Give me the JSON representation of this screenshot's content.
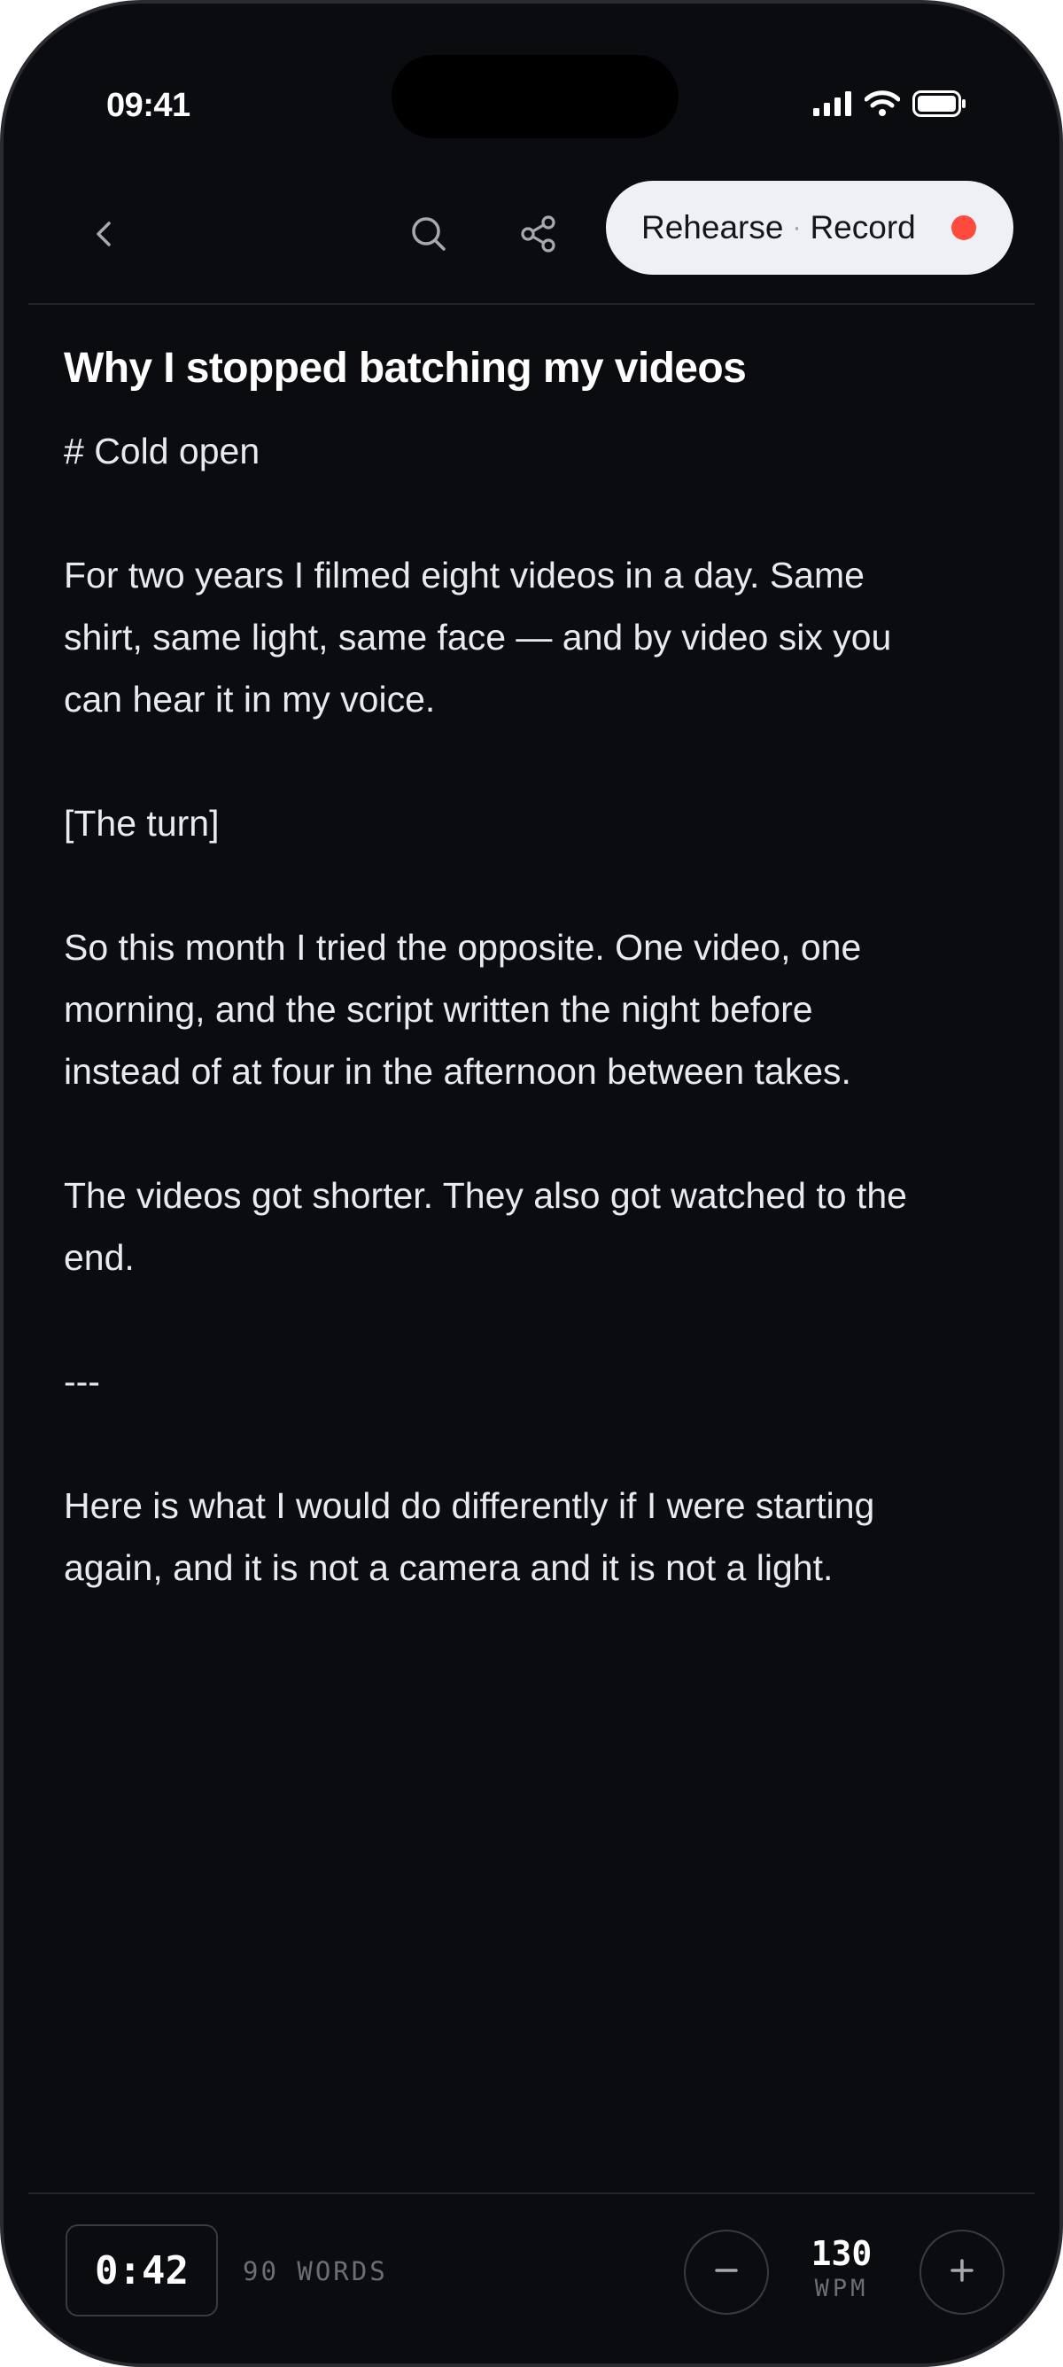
{
  "status_bar": {
    "time": "09:41",
    "icons": [
      "cellular-signal-icon",
      "wifi-icon",
      "battery-icon"
    ]
  },
  "toolbar": {
    "back_icon": "chevron-left-icon",
    "search_icon": "search-icon",
    "share_icon": "share-icon",
    "mode_primary": "Rehearse",
    "mode_separator": "·",
    "mode_secondary": "Record",
    "record_dot_color": "#ff4b3e"
  },
  "document": {
    "title": "Why I stopped batching my videos",
    "lines": [
      "# Cold open",
      "",
      "For two years I filmed eight videos in a day. Same",
      "shirt, same light, same face — and by video six you",
      "can hear it in my voice.",
      "",
      "[The turn]",
      "",
      "So this month I tried the opposite. One video, one",
      "morning, and the script written the night before",
      "instead of at four in the afternoon between takes.",
      "",
      "The videos got shorter. They also got watched to the",
      "end.",
      "",
      "---",
      "",
      "Here is what I would do differently if I were starting",
      "again, and it is not a camera and it is not a light."
    ]
  },
  "footer": {
    "duration": "0:42",
    "word_count": "90 WORDS",
    "decrease_icon": "minus-icon",
    "increase_icon": "plus-icon",
    "wpm_value": "130",
    "wpm_unit": "WPM"
  }
}
